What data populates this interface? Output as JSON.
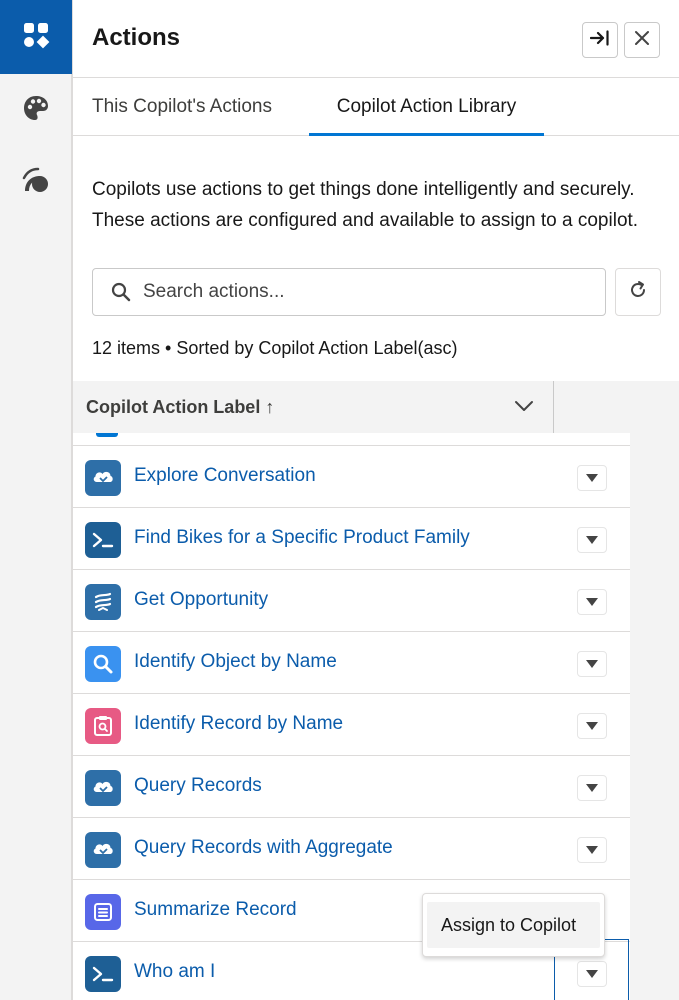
{
  "panel": {
    "title": "Actions"
  },
  "tabs": [
    {
      "label": "This Copilot's Actions",
      "active": false
    },
    {
      "label": "Copilot Action Library",
      "active": true
    }
  ],
  "description": "Copilots use actions to get things done intelligently and securely. These actions are configured and available to assign to a copilot.",
  "search": {
    "placeholder": "Search actions...",
    "value": ""
  },
  "list_meta": "12 items • Sorted by Copilot Action Label(asc)",
  "table": {
    "column_header": "Copilot Action Label ↑",
    "rows": [
      {
        "label": "Explore Conversation",
        "icon": "cloud-flow-icon",
        "color": "#2e6fa8"
      },
      {
        "label": "Find Bikes for a Specific Product Family",
        "icon": "terminal-icon",
        "color": "#1e5f95"
      },
      {
        "label": "Get Opportunity",
        "icon": "flow-icon",
        "color": "#2e6fa8"
      },
      {
        "label": "Identify Object by Name",
        "icon": "search-icon",
        "color": "#3a92f0"
      },
      {
        "label": "Identify Record by Name",
        "icon": "record-search-icon",
        "color": "#e75a84"
      },
      {
        "label": "Query Records",
        "icon": "cloud-flow-icon",
        "color": "#2e6fa8"
      },
      {
        "label": "Query Records with Aggregate",
        "icon": "cloud-flow-icon",
        "color": "#2e6fa8"
      },
      {
        "label": "Summarize Record",
        "icon": "document-icon",
        "color": "#5867e8"
      },
      {
        "label": "Who am I",
        "icon": "terminal-icon",
        "color": "#1e5f95"
      }
    ]
  },
  "dropdown": {
    "item": "Assign to Copilot"
  },
  "colors": {
    "brand": "#0176d3",
    "link": "#0b5cab",
    "rail_active": "#0b5cab"
  }
}
